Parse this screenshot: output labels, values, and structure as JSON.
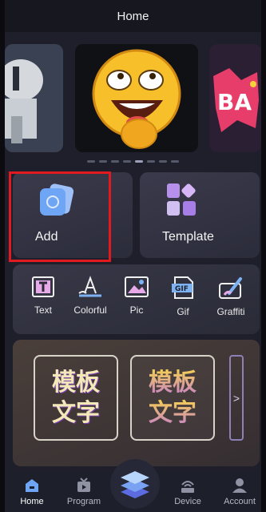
{
  "header": {
    "title": "Home"
  },
  "carousel": {
    "slides": [
      "banner-left",
      "emoji-sticker",
      "bam-sticker"
    ],
    "active_index": 4,
    "dot_count": 8,
    "right_slide_text": "BA"
  },
  "actions": {
    "add_label": "Add",
    "template_label": "Template"
  },
  "tools": [
    {
      "label": "Text",
      "icon": "text-t-icon"
    },
    {
      "label": "Colorful",
      "icon": "colorful-a-icon"
    },
    {
      "label": "Pic",
      "icon": "image-icon"
    },
    {
      "label": "Gif",
      "icon": "gif-icon"
    },
    {
      "label": "Graffiti",
      "icon": "brush-icon"
    }
  ],
  "font_cards": [
    {
      "line1": "模板",
      "line2": "文字"
    },
    {
      "line1": "模板",
      "line2": "文字"
    }
  ],
  "more_symbol": ">",
  "bottom_nav": [
    {
      "label": "Home",
      "icon": "home-icon",
      "active": true
    },
    {
      "label": "Program",
      "icon": "program-icon",
      "active": false
    },
    {
      "label": "",
      "icon": "layers-icon",
      "active": false
    },
    {
      "label": "Device",
      "icon": "device-icon",
      "active": false
    },
    {
      "label": "Account",
      "icon": "account-icon",
      "active": false
    }
  ],
  "colors": {
    "background": "#1e1f2b",
    "highlight": "#e01a1f",
    "accent_blue": "#6ea6f5"
  }
}
